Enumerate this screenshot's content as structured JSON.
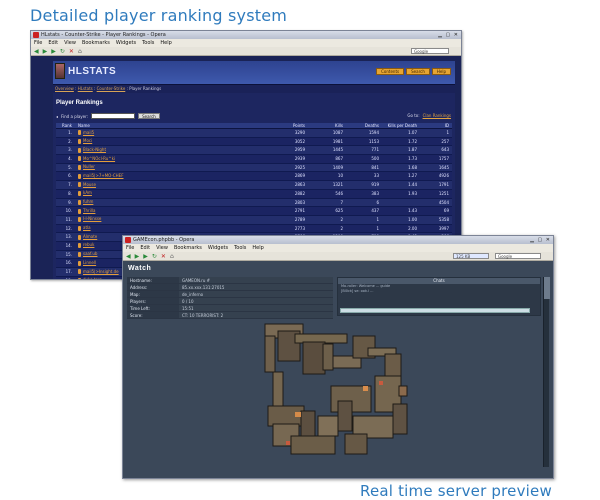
{
  "captions": {
    "top": "Detailed player ranking system",
    "bottom": "Real time server preview"
  },
  "window1": {
    "title": "HLstats - Counter-Strike - Player Rankings - Opera",
    "menu": [
      "File",
      "Edit",
      "View",
      "Bookmarks",
      "Widgets",
      "Tools",
      "Help"
    ],
    "search_placeholder": "Google",
    "page": {
      "logo": "HLSTATS",
      "top_buttons": [
        "Contents",
        "Search",
        "Help"
      ],
      "breadcrumb": [
        "Overview",
        "HLstats",
        "Counter-Strike",
        "Player Rankings"
      ],
      "heading": "Player Rankings",
      "find_label": "Find a player:",
      "search_button": "Search",
      "goto_label": "Go to:",
      "goto_link": "Clan Rankings",
      "columns": [
        "Rank",
        "Name",
        "Points",
        "Kills",
        "Deaths",
        "Kills per Death",
        "ID"
      ],
      "rows": [
        {
          "rank": "1.",
          "name": "mail5",
          "points": "3290",
          "kills": "1087",
          "deaths": "1594",
          "kpd": "1.07",
          "id": "1"
        },
        {
          "rank": "2.",
          "name": "Moci",
          "points": "3052",
          "kills": "1981",
          "deaths": "1153",
          "kpd": "1.72",
          "id": "257"
        },
        {
          "rank": "3.",
          "name": "Black-Night",
          "points": "2959",
          "kills": "1445",
          "deaths": "771",
          "kpd": "1.87",
          "id": "643"
        },
        {
          "rank": "4.",
          "name": "Mo^NOcl-Ru^ki",
          "points": "2939",
          "kills": "867",
          "deaths": "500",
          "kpd": "1.73",
          "id": "1757"
        },
        {
          "rank": "5.",
          "name": "Nuller",
          "points": "2925",
          "kills": "1409",
          "deaths": "841",
          "kpd": "1.68",
          "id": "1645"
        },
        {
          "rank": "6.",
          "name": "mail5|>7+MO-CHEF",
          "points": "2869",
          "kills": "10",
          "deaths": "33",
          "kpd": "1.27",
          "id": "4926"
        },
        {
          "rank": "7.",
          "name": "Mouse",
          "points": "2863",
          "kills": "1321",
          "deaths": "919",
          "kpd": "1.44",
          "id": "1791"
        },
        {
          "rank": "8.",
          "name": "kAm",
          "points": "2882",
          "kills": "546",
          "deaths": "383",
          "kpd": "1.93",
          "id": "1251"
        },
        {
          "rank": "9.",
          "name": "fuhm",
          "points": "2803",
          "kills": "7",
          "deaths": "6",
          "kpd": "",
          "id": "4504"
        },
        {
          "rank": "10.",
          "name": "Thrilla",
          "points": "2791",
          "kills": "625",
          "deaths": "437",
          "kpd": "1.43",
          "id": "69"
        },
        {
          "rank": "11.",
          "name": "l-l-Ninsse",
          "points": "2789",
          "kills": "2",
          "deaths": "1",
          "kpd": "1.00",
          "id": "5358"
        },
        {
          "rank": "12.",
          "name": "atla",
          "points": "2773",
          "kills": "2",
          "deaths": "1",
          "kpd": "2.00",
          "id": "3997"
        },
        {
          "rank": "13.",
          "name": "Almate",
          "points": "2766",
          "kills": "1200",
          "deaths": "790",
          "kpd": "1.42",
          "id": "366"
        },
        {
          "rank": "14.",
          "name": "rebuk",
          "points": "",
          "kills": "",
          "deaths": "",
          "kpd": "",
          "id": ""
        },
        {
          "rank": "15.",
          "name": "saaf.ub",
          "points": "",
          "kills": "",
          "deaths": "",
          "kpd": "",
          "id": ""
        },
        {
          "rank": "16.",
          "name": "Linnell",
          "points": "",
          "kills": "",
          "deaths": "",
          "kpd": "",
          "id": ""
        },
        {
          "rank": "17.",
          "name": "mail5|>Insight.de",
          "points": "",
          "kills": "",
          "deaths": "",
          "kpd": "",
          "id": ""
        },
        {
          "rank": "18.",
          "name": "duke tera",
          "points": "",
          "kills": "",
          "deaths": "",
          "kpd": "",
          "id": ""
        }
      ]
    }
  },
  "window2": {
    "title": "GAMEcon.phpbb - Opera",
    "menu": [
      "File",
      "Edit",
      "View",
      "Bookmarks",
      "Widgets",
      "Tools",
      "Help"
    ],
    "zoom": "125 KB",
    "search_placeholder": "Google",
    "page": {
      "heading": "Watch",
      "info": [
        {
          "key": "Hostname:",
          "value": "GAMEON.ru #"
        },
        {
          "key": "Address:",
          "value": "85.xx.xxx.131:27015"
        },
        {
          "key": "Map:",
          "value": "de_inferno"
        },
        {
          "key": "Players:",
          "value": "0 / 10"
        },
        {
          "key": "Time Left:",
          "value": "15:51"
        },
        {
          "key": "Score:",
          "value": "CT: 10 TERRORIST: 2"
        }
      ],
      "chat_title": "Chats",
      "chat_lines": [
        "Mo-roller: Welcome ... guide",
        "[Bl0ck] se: ook.l ..."
      ]
    }
  }
}
